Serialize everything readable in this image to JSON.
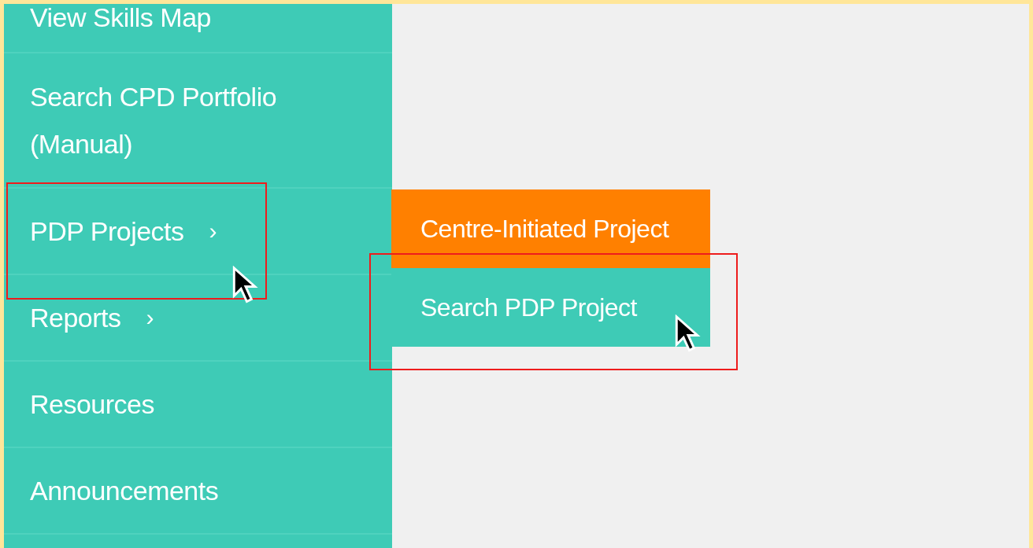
{
  "sidebar": {
    "items": [
      {
        "label": "View Skills Map"
      },
      {
        "label": "Search CPD Portfolio (Manual)"
      },
      {
        "label": "PDP Projects",
        "arrow": "›"
      },
      {
        "label": "Reports",
        "arrow": "›"
      },
      {
        "label": "Resources"
      },
      {
        "label": "Announcements"
      }
    ]
  },
  "submenu": {
    "items": [
      {
        "label": "Centre-Initiated Project",
        "highlighted": true
      },
      {
        "label": "Search PDP Project",
        "highlighted": false
      }
    ]
  }
}
